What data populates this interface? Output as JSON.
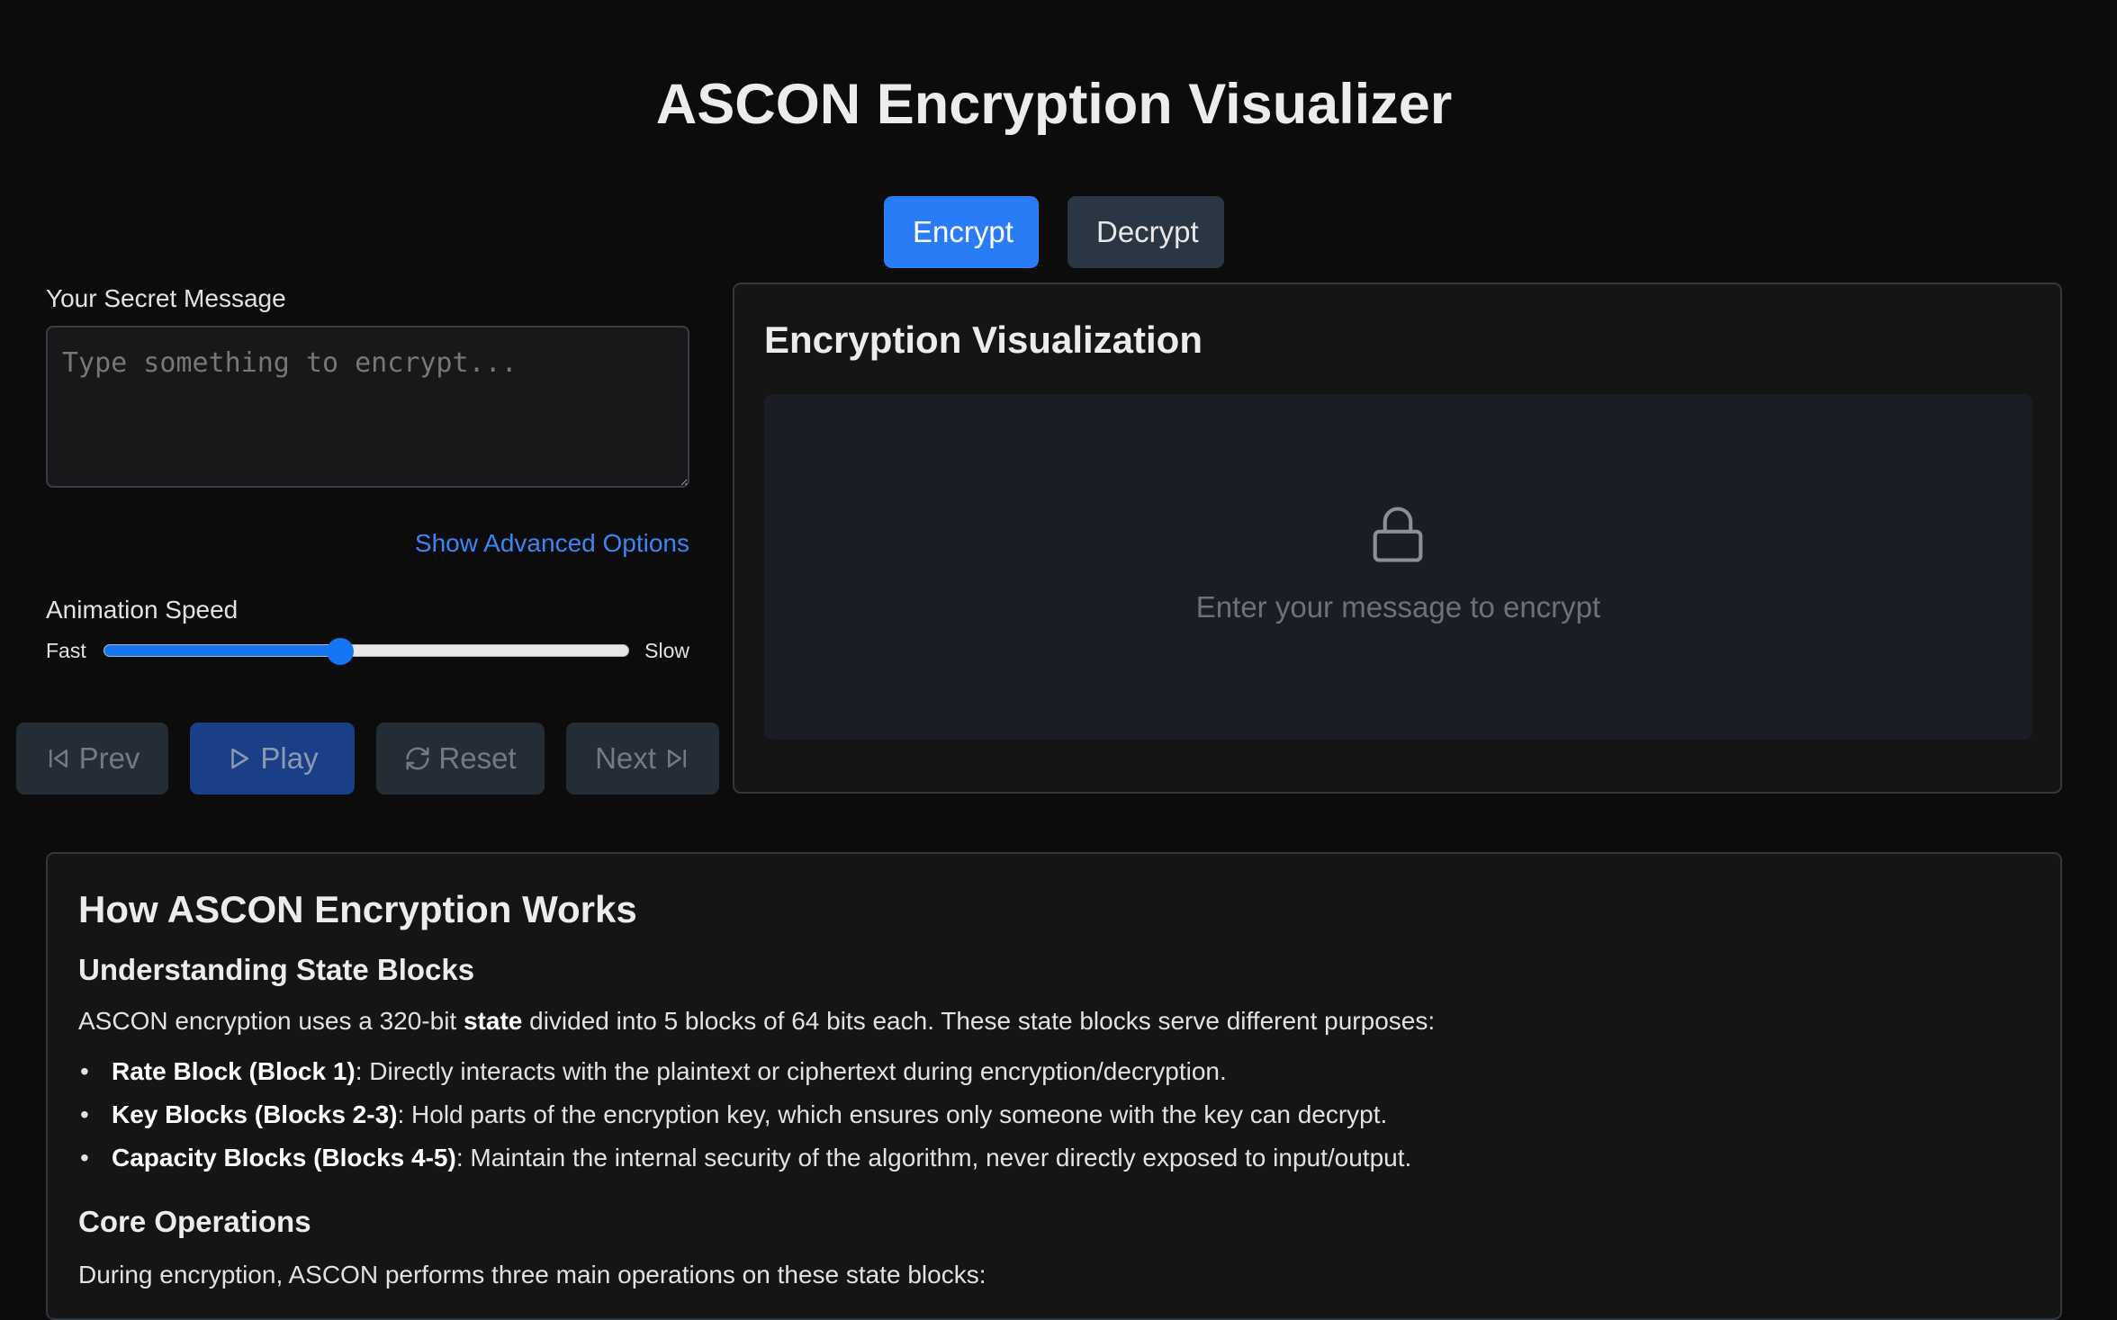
{
  "header": {
    "title": "ASCON Encryption Visualizer"
  },
  "mode_tabs": [
    {
      "label": "Encrypt",
      "active": true
    },
    {
      "label": "Decrypt",
      "active": false
    }
  ],
  "message": {
    "label": "Your Secret Message",
    "value": "",
    "placeholder": "Type something to encrypt..."
  },
  "advanced_link": "Show Advanced Options",
  "speed": {
    "label": "Animation Speed",
    "min_label": "Fast",
    "max_label": "Slow",
    "value_fraction": 0.45
  },
  "controls": {
    "prev": "Prev",
    "play": "Play",
    "reset": "Reset",
    "next": "Next"
  },
  "visualization": {
    "title": "Encryption Visualization",
    "empty_message": "Enter your message to encrypt",
    "icon": "lock-icon"
  },
  "how": {
    "title": "How ASCON Encryption Works",
    "state_blocks": {
      "heading": "Understanding State Blocks",
      "intro_pre": "ASCON encryption uses a 320-bit ",
      "intro_bold": "state",
      "intro_post": " divided into 5 blocks of 64 bits each. These state blocks serve different purposes:",
      "items": [
        {
          "term": "Rate Block (Block 1)",
          "desc": ": Directly interacts with the plaintext or ciphertext during encryption/decryption."
        },
        {
          "term": "Key Blocks (Blocks 2-3)",
          "desc": ": Hold parts of the encryption key, which ensures only someone with the key can decrypt."
        },
        {
          "term": "Capacity Blocks (Blocks 4-5)",
          "desc": ": Maintain the internal security of the algorithm, never directly exposed to input/output."
        }
      ]
    },
    "core_ops": {
      "heading": "Core Operations",
      "intro": "During encryption, ASCON performs three main operations on these state blocks:"
    }
  },
  "colors": {
    "accent": "#2a7cf6",
    "background": "#0c0c0d",
    "panel": "#151516",
    "link": "#3b86f7"
  }
}
